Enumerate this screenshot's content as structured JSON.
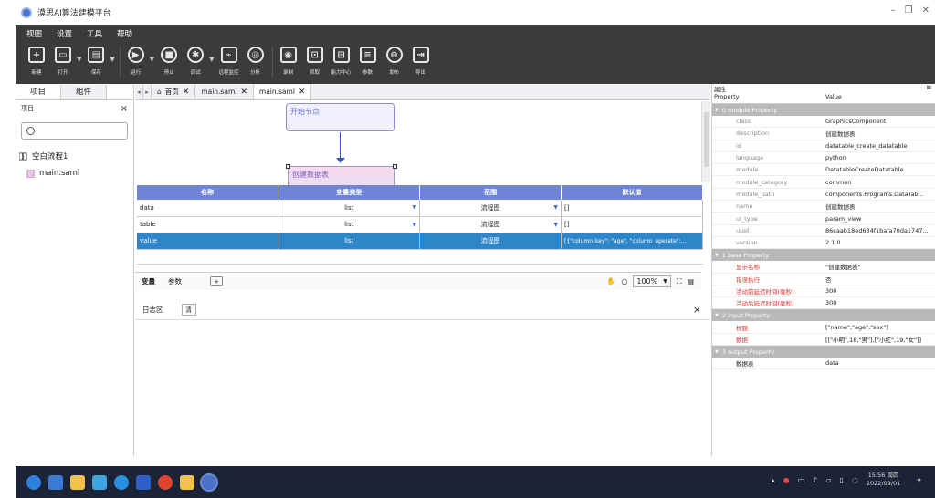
{
  "window": {
    "title": "漠思AI算法建模平台"
  },
  "menu": [
    "视图",
    "设置",
    "工具",
    "帮助"
  ],
  "toolbar": {
    "new": "新建",
    "open": "打开",
    "save": "保存",
    "run": "运行",
    "stop": "停止",
    "debug": "调试",
    "remote_monitor": "远程监控",
    "analyze": "分析",
    "record": "录制",
    "capture": "抓取",
    "capability_center": "能力中心",
    "params": "参数",
    "publish": "发布",
    "export": "导出"
  },
  "left_panel": {
    "tab_project": "项目",
    "tab_components": "组件",
    "header": "项目",
    "close": "×",
    "tree_root": "空白流程1",
    "tree_file": "main.saml"
  },
  "doc_tabs": {
    "home": "首页",
    "tab1": "main.saml",
    "tab2": "main.saml"
  },
  "canvas": {
    "node_start": "开始节点",
    "node_create": "创建数据表"
  },
  "table": {
    "headers": [
      "名称",
      "变量类型",
      "范围",
      "默认值"
    ],
    "rows": [
      {
        "name": "data",
        "type": "list",
        "scope": "流程图",
        "default": "[]"
      },
      {
        "name": "table",
        "type": "list",
        "scope": "流程图",
        "default": "[]"
      },
      {
        "name": "value",
        "type": "list",
        "scope": "流程图",
        "default": "[{\"column_key\": \"age\", \"column_operate\":..."
      }
    ]
  },
  "bottom_tabs": {
    "variables": "变量",
    "params": "参数",
    "add": "+",
    "zoom": "100%"
  },
  "log": {
    "title": "日志区",
    "clear": "清",
    "close": "×"
  },
  "properties": {
    "title": "属性",
    "col_property": "Property",
    "col_value": "Value",
    "sections": [
      {
        "name": "0 module Property",
        "rows": [
          {
            "k": "class",
            "v": "GraphicsComponent"
          },
          {
            "k": "description",
            "v": "创建数据表"
          },
          {
            "k": "id",
            "v": "datatable_create_datatable"
          },
          {
            "k": "language",
            "v": "python"
          },
          {
            "k": "module",
            "v": "DatatableCreateDatatable"
          },
          {
            "k": "module_category",
            "v": "common"
          },
          {
            "k": "module_path",
            "v": "components.Programs.DataTab..."
          },
          {
            "k": "name",
            "v": "创建数据表"
          },
          {
            "k": "ui_type",
            "v": "param_view"
          },
          {
            "k": "uuid",
            "v": "86caab18ed634f1bafa70da1747..."
          },
          {
            "k": "version",
            "v": "2.1.0"
          }
        ]
      },
      {
        "name": "1 base Property",
        "rows": [
          {
            "k": "显示名称",
            "v": "\"创建数据表\""
          },
          {
            "k": "错误执行",
            "v": "否"
          },
          {
            "k": "活动前延迟时间(毫秒)",
            "v": "300"
          },
          {
            "k": "活动后延迟时间(毫秒)",
            "v": "300"
          }
        ]
      },
      {
        "name": "2 input Property",
        "rows": [
          {
            "k": "标题",
            "v": "[\"name\",\"age\",\"sex\"]"
          },
          {
            "k": "数据",
            "v": "[[\"小明\",18,\"男\"],[\"小红\",19,\"女\"]]"
          }
        ]
      },
      {
        "name": "3 output Property",
        "rows": [
          {
            "k": "数据表",
            "v": "data"
          }
        ]
      }
    ]
  },
  "taskbar": {
    "time": "15:56 周四",
    "date": "2022/09/01"
  }
}
